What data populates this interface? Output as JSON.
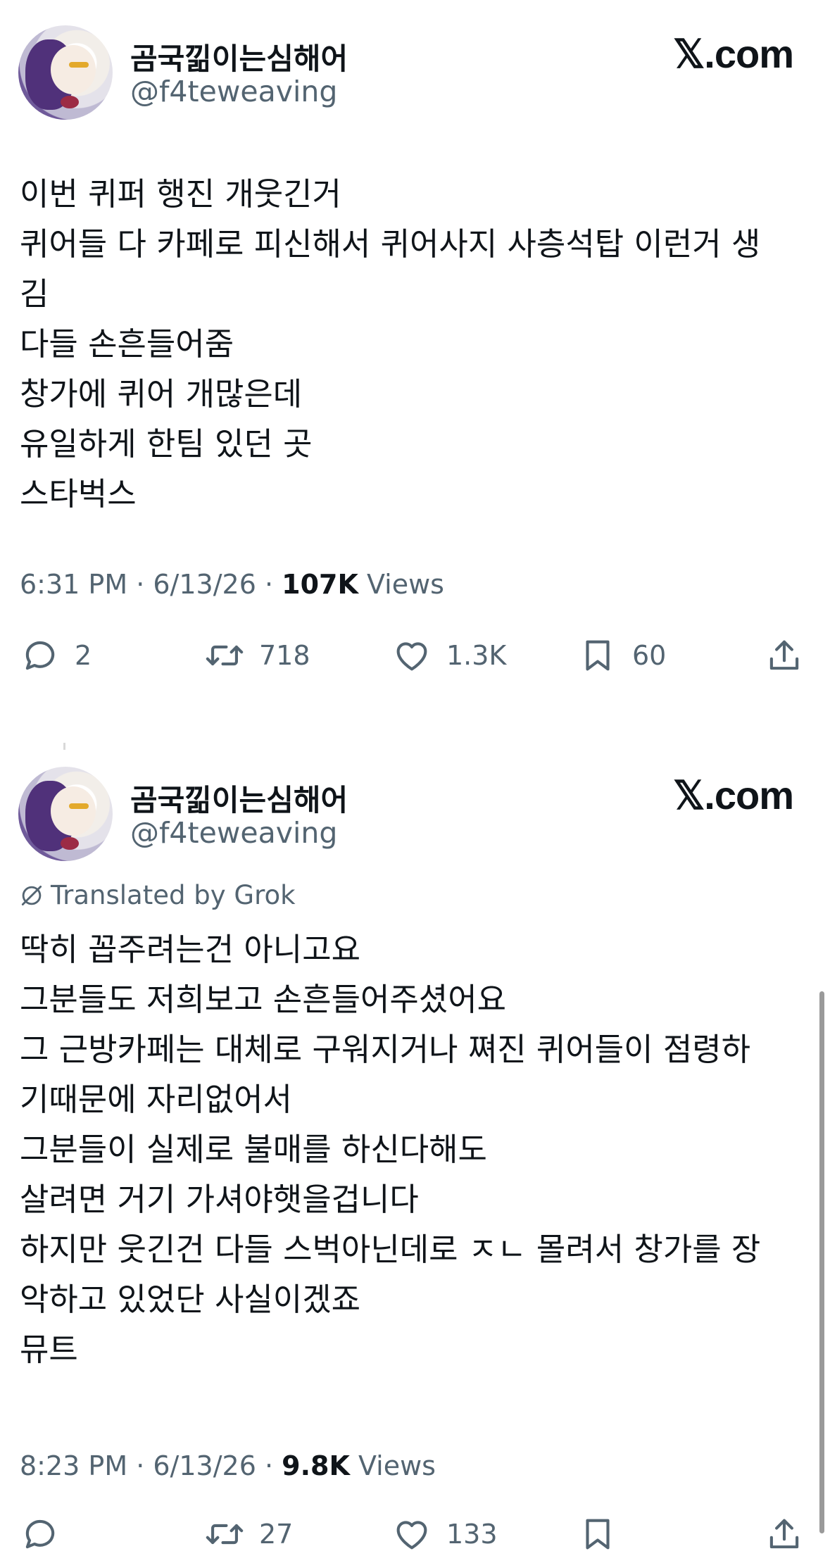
{
  "tweets": [
    {
      "author": {
        "display_name": "곰국낆이는심해어",
        "handle": "@f4teweaving"
      },
      "brand": "𝕏.com",
      "body_lines": [
        "이번 퀴퍼 행진 개웃긴거",
        "퀴어들 다 카페로 피신해서 퀴어사지 사층석탑 이런거 생",
        "김",
        "다들 손흔들어줌",
        "창가에 퀴어 개많은데",
        "유일하게 한팀 있던 곳",
        "스타벅스"
      ],
      "meta": {
        "time": "6:31 PM",
        "sep": " · ",
        "date": "6/13/26",
        "views_count": "107K",
        "views_label": "Views"
      },
      "actions": {
        "replies": "2",
        "reposts": "718",
        "likes": "1.3K",
        "bookmarks": "60"
      }
    },
    {
      "author": {
        "display_name": "곰국낆이는심해어",
        "handle": "@f4teweaving"
      },
      "brand": "𝕏.com",
      "translated_label": "Translated by Grok",
      "body_lines": [
        "딱히 꼽주려는건 아니고요",
        "그분들도 저희보고 손흔들어주셨어요",
        "그 근방카페는 대체로 구워지거나 쪄진 퀴어들이 점령하",
        "기때문에 자리없어서",
        "그분들이 실제로 불매를 하신다해도",
        "살려면 거기 가셔야햇을겁니다",
        "하지만 웃긴건 다들 스벅아닌데로 ㅈㄴ 몰려서 창가를 장",
        "악하고 있었단 사실이겠죠",
        "뮤트"
      ],
      "meta": {
        "time": "8:23 PM",
        "sep": " · ",
        "date": "6/13/26",
        "views_count": "9.8K",
        "views_label": "Views"
      },
      "actions": {
        "replies": "",
        "reposts": "27",
        "likes": "133",
        "bookmarks": ""
      }
    }
  ],
  "icons": {
    "reply": "reply-icon",
    "repost": "repost-icon",
    "like": "heart-icon",
    "bookmark": "bookmark-icon",
    "share": "share-icon",
    "translate": "translate-icon"
  },
  "colors": {
    "text": "#0f1419",
    "secondary": "#536471",
    "background": "#ffffff"
  }
}
